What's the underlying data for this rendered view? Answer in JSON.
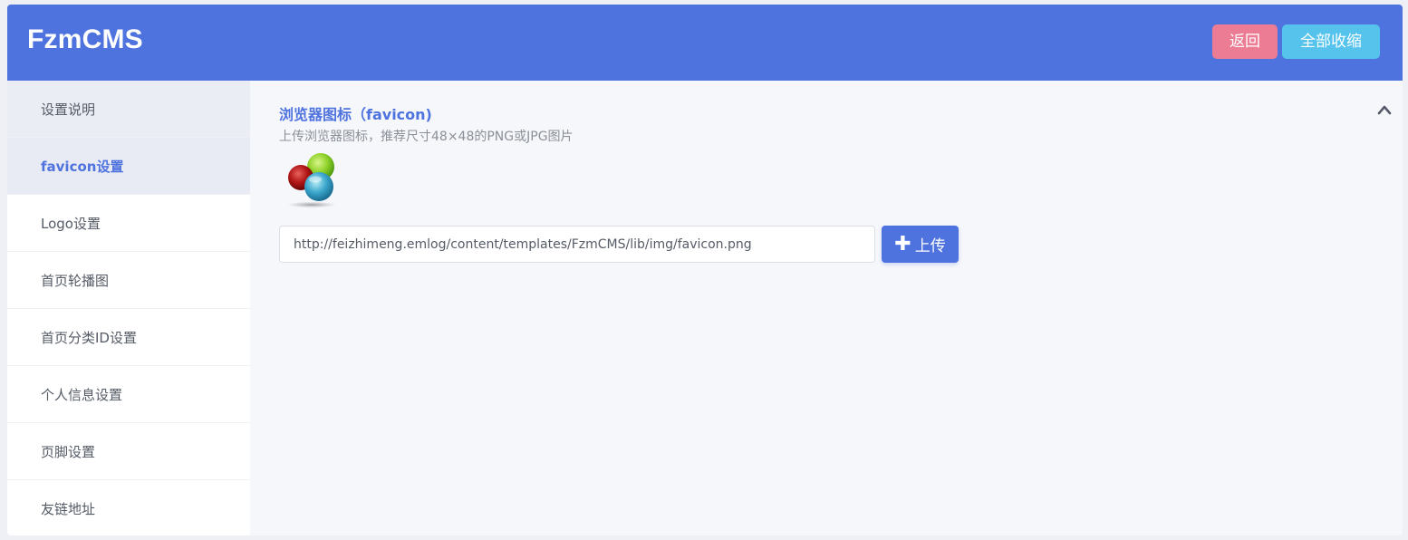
{
  "header": {
    "brand": "FzmCMS",
    "back_label": "返回",
    "collapse_all_label": "全部收缩",
    "colors": {
      "bar": "#4f73de",
      "back": "#ec7b94",
      "collapse": "#55c3ec"
    }
  },
  "sidebar": {
    "items": [
      {
        "label": "设置说明"
      },
      {
        "label": "favicon设置",
        "active": true
      },
      {
        "label": "Logo设置"
      },
      {
        "label": "首页轮播图"
      },
      {
        "label": "首页分类ID设置"
      },
      {
        "label": "个人信息设置"
      },
      {
        "label": "页脚设置"
      },
      {
        "label": "友链地址"
      }
    ]
  },
  "section": {
    "title": "浏览器图标（favicon)",
    "description": "上传浏览器图标，推荐尺寸48×48的PNG或JPG图片",
    "collapse_icon": "chevron-up-icon",
    "preview_icon": "favicon-image",
    "url_value": "http://feizhimeng.emlog/content/templates/FzmCMS/lib/img/favicon.png",
    "upload_icon": "plus-icon",
    "upload_label": "上传"
  }
}
